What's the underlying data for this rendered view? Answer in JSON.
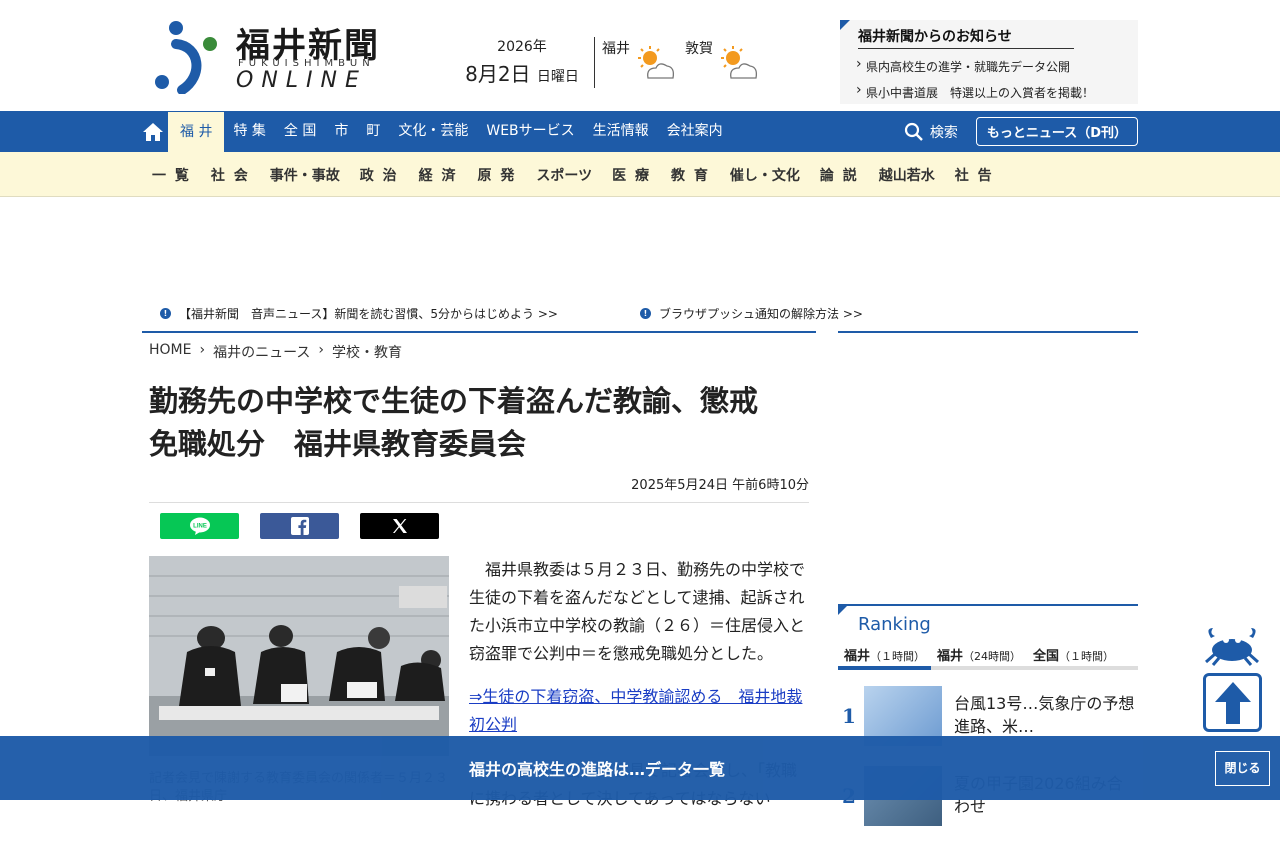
{
  "header": {
    "logo_title": "福井新聞",
    "logo_roman": "FUKUISHIMBUN",
    "logo_online": "ONLINE",
    "date_year": "2026年",
    "date_main": "8月2日",
    "date_weekday": "日曜日",
    "weather": [
      {
        "name": "福井",
        "icon": "sun-cloud-icon"
      },
      {
        "name": "敦賀",
        "icon": "sun-cloud-icon"
      }
    ],
    "notice_title": "福井新聞からのお知らせ",
    "notice_items": [
      "県内高校生の進学・就職先データ公開",
      "県小中書道展　特選以上の入賞者を掲載！"
    ]
  },
  "nav": {
    "items": [
      "福 井",
      "特 集",
      "全 国",
      "市",
      "町",
      "文化・芸能",
      "WEBサービス",
      "生活情報",
      "会社案内"
    ],
    "active_index": 0,
    "search_label": "検索",
    "more_news_label": "もっとニュース（D刊）"
  },
  "subnav": {
    "items": [
      "一 覧",
      "社 会",
      "事件・事故",
      "政 治",
      "経 済",
      "原 発",
      "スポーツ",
      "医 療",
      "教 育",
      "催し・文化",
      "論 説",
      "越山若水",
      "社 告"
    ]
  },
  "announcements": [
    "【福井新聞　音声ニュース】新聞を読む習慣、5分からはじめよう >>",
    "ブラウザプッシュ通知の解除方法 >>"
  ],
  "breadcrumb": [
    "HOME",
    "福井のニュース",
    "学校・教育"
  ],
  "article": {
    "title_line1": "勤務先の中学校で生徒の下着盗んだ教諭、懲戒",
    "title_line2": "免職処分　福井県教育委員会",
    "date": "2025年5月24日 午前6時10分",
    "body": "　福井県教委は５月２３日、勤務先の中学校で生徒の下着を盗んだなどとして逮捕、起訴された小浜市立中学校の教諭（２６）＝住居侵入と窃盗罪で公判中＝を懲戒免職処分とした。",
    "link": "⇒生徒の下着窃盗、中学教諭認める　福井地裁初公判",
    "body2": "　県教委の担当者は会見で記者会見し、「教職に携わる者として決してあってはならない",
    "caption": "記者会見で陳謝する教育委員会の関係者＝５月２３日、福井県庁"
  },
  "share": [
    {
      "name": "line",
      "color": "#06c755"
    },
    {
      "name": "facebook",
      "color": "#3b5998"
    },
    {
      "name": "x",
      "color": "#000000"
    }
  ],
  "ranking": {
    "title": "Ranking",
    "tabs": [
      {
        "label": "福井",
        "sub": "（１時間）"
      },
      {
        "label": "福井",
        "sub": "（24時間）"
      },
      {
        "label": "全国",
        "sub": "（１時間）"
      }
    ],
    "items": [
      {
        "rank": "1",
        "text": "台風13号…気象庁の予想進路、米…"
      },
      {
        "rank": "2",
        "text": "夏の甲子園2026組み合わせ"
      }
    ]
  },
  "bottom_bar": {
    "text": "福井の高校生の進路は…データ一覧",
    "close_label": "閉じる"
  },
  "colors": {
    "brand_blue": "#1e5ba8",
    "subnav_bg": "#fdf8d8",
    "link": "#1a3dc4"
  }
}
